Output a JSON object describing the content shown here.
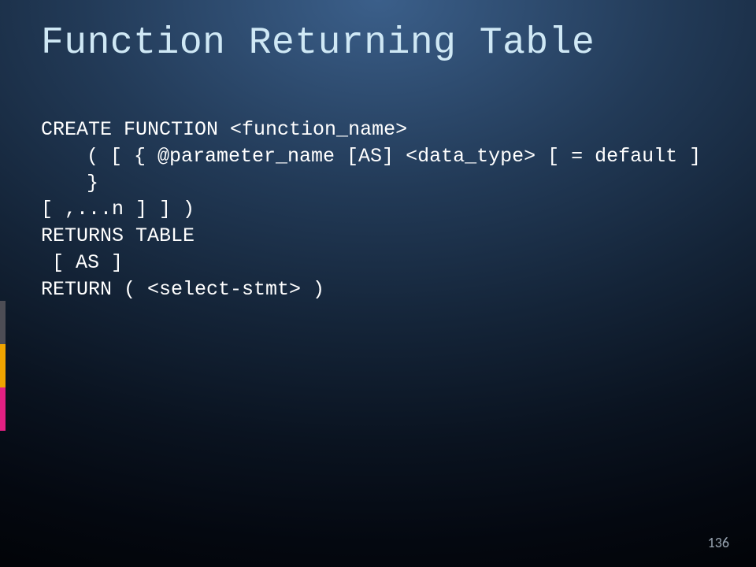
{
  "slide": {
    "title": "Function Returning Table",
    "body_lines": [
      {
        "class": "",
        "text": "CREATE FUNCTION <function_name>"
      },
      {
        "class": "indent1",
        "text": "( [ { @parameter_name [AS] <data_type> [ = default ] }"
      },
      {
        "class": "",
        "text": "[ ,...n ] ] )"
      },
      {
        "class": "",
        "text": "RETURNS TABLE"
      },
      {
        "class": "indent-small",
        "text": "[ AS ]"
      },
      {
        "class": "",
        "text": "RETURN ( <select-stmt> )"
      }
    ],
    "page_number": "136"
  }
}
